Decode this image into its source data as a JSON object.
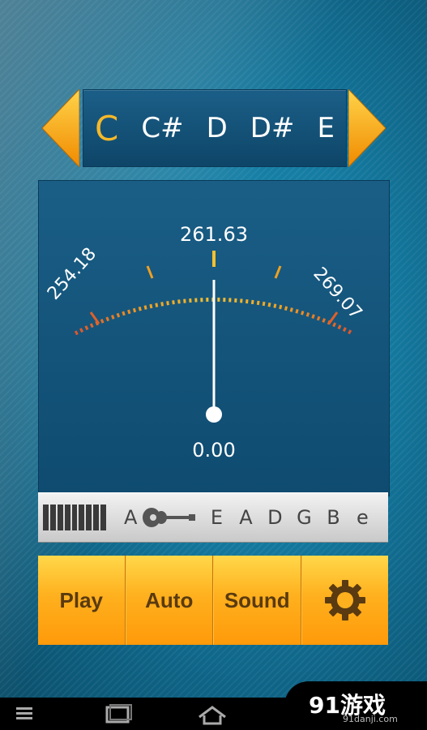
{
  "note_selector": {
    "notes": [
      "C",
      "C#",
      "D",
      "D#",
      "E"
    ],
    "active_index": 0
  },
  "meter": {
    "center_freq": "261.63",
    "low_freq": "254.18",
    "high_freq": "269.07",
    "deviation": "0.00"
  },
  "mode_bar": {
    "mode_note": "A",
    "strings": [
      "E",
      "A",
      "D",
      "G",
      "B",
      "e"
    ]
  },
  "buttons": {
    "play": "Play",
    "auto": "Auto",
    "sound": "Sound"
  },
  "brand": {
    "main": "91游戏",
    "sub": "91danji.com"
  },
  "colors": {
    "accent_orange": "#ffb01e",
    "active_note": "#f5b82a",
    "panel_blue": "#1a5e86"
  }
}
